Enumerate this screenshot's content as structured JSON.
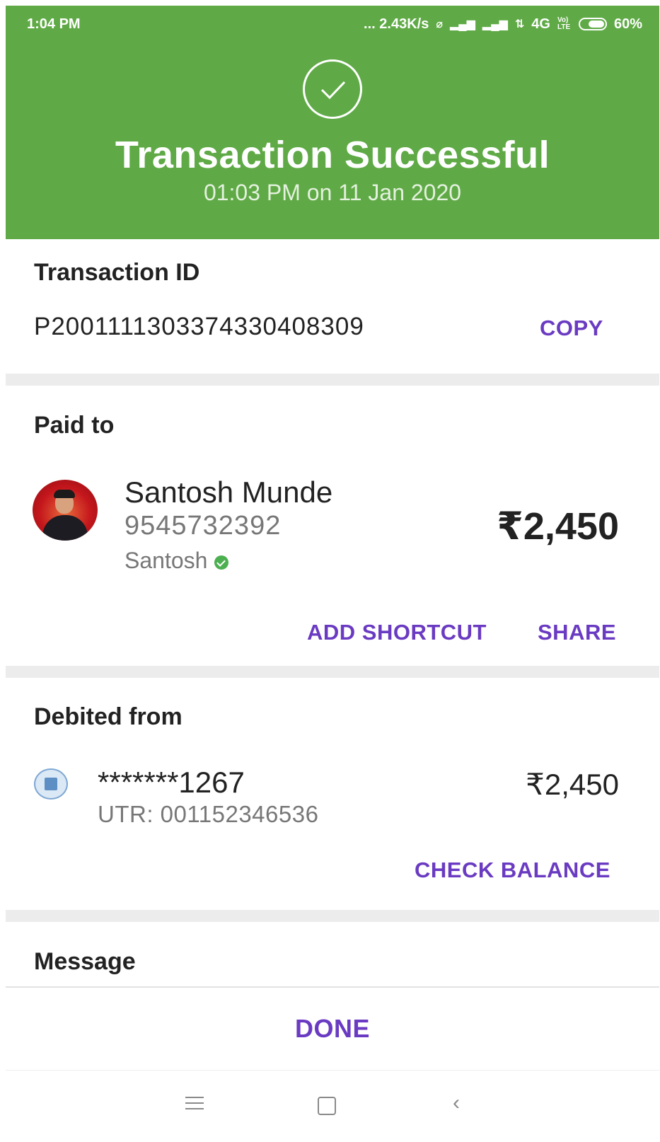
{
  "status_bar": {
    "time": "1:04 PM",
    "network_speed": "... 2.43K/s",
    "network_type": "4G",
    "volte": "Vo) LTE",
    "battery": "60%"
  },
  "header": {
    "title": "Transaction Successful",
    "datetime": "01:03 PM on 11 Jan 2020",
    "color": "#5faa46"
  },
  "transaction": {
    "label": "Transaction ID",
    "id": "P2001111303374330408309",
    "copy_label": "COPY"
  },
  "paid_to": {
    "label": "Paid to",
    "name": "Santosh Munde",
    "phone": "9545732392",
    "upi_name": "Santosh",
    "amount": "₹2,450",
    "add_shortcut_label": "ADD SHORTCUT",
    "share_label": "SHARE"
  },
  "debited_from": {
    "label": "Debited from",
    "account": "*******1267",
    "utr": "UTR: 001152346536",
    "amount": "₹2,450",
    "check_balance_label": "CHECK BALANCE"
  },
  "message": {
    "label": "Message"
  },
  "footer": {
    "done_label": "DONE"
  },
  "colors": {
    "accent": "#6a3bc2",
    "success": "#5faa46"
  }
}
